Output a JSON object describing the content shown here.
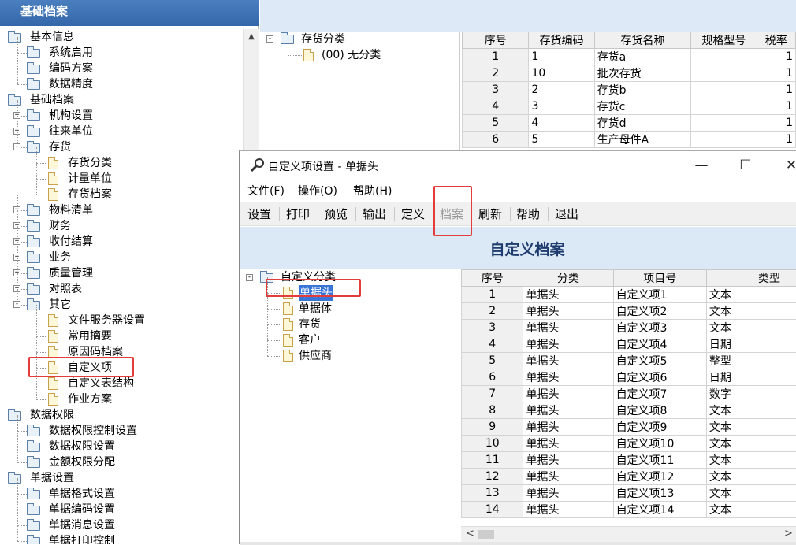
{
  "left_panel": {
    "title": "基础档案",
    "tree": [
      {
        "label": "基本信息",
        "level": 0,
        "type": "folder",
        "pm": ""
      },
      {
        "label": "系统启用",
        "level": 1,
        "type": "folder",
        "pm": ""
      },
      {
        "label": "编码方案",
        "level": 1,
        "type": "folder",
        "pm": ""
      },
      {
        "label": "数据精度",
        "level": 1,
        "type": "folder",
        "pm": ""
      },
      {
        "label": "基础档案",
        "level": 0,
        "type": "folder",
        "pm": ""
      },
      {
        "label": "机构设置",
        "level": 1,
        "type": "folder",
        "pm": "+"
      },
      {
        "label": "往来单位",
        "level": 1,
        "type": "folder",
        "pm": "+"
      },
      {
        "label": "存货",
        "level": 1,
        "type": "folder",
        "pm": "-"
      },
      {
        "label": "存货分类",
        "level": 2,
        "type": "doc",
        "pm": ""
      },
      {
        "label": "计量单位",
        "level": 2,
        "type": "doc",
        "pm": ""
      },
      {
        "label": "存货档案",
        "level": 2,
        "type": "doc",
        "pm": ""
      },
      {
        "label": "物料清单",
        "level": 1,
        "type": "folder",
        "pm": "+"
      },
      {
        "label": "财务",
        "level": 1,
        "type": "folder",
        "pm": "+"
      },
      {
        "label": "收付结算",
        "level": 1,
        "type": "folder",
        "pm": "+"
      },
      {
        "label": "业务",
        "level": 1,
        "type": "folder",
        "pm": "+"
      },
      {
        "label": "质量管理",
        "level": 1,
        "type": "folder",
        "pm": "+"
      },
      {
        "label": "对照表",
        "level": 1,
        "type": "folder",
        "pm": "+"
      },
      {
        "label": "其它",
        "level": 1,
        "type": "folder",
        "pm": "-"
      },
      {
        "label": "文件服务器设置",
        "level": 2,
        "type": "doc",
        "pm": ""
      },
      {
        "label": "常用摘要",
        "level": 2,
        "type": "doc",
        "pm": ""
      },
      {
        "label": "原因码档案",
        "level": 2,
        "type": "doc",
        "pm": ""
      },
      {
        "label": "自定义项",
        "level": 2,
        "type": "doc",
        "pm": ""
      },
      {
        "label": "自定义表结构",
        "level": 2,
        "type": "doc",
        "pm": ""
      },
      {
        "label": "作业方案",
        "level": 2,
        "type": "doc",
        "pm": ""
      },
      {
        "label": "数据权限",
        "level": 0,
        "type": "folder",
        "pm": ""
      },
      {
        "label": "数据权限控制设置",
        "level": 1,
        "type": "folder",
        "pm": ""
      },
      {
        "label": "数据权限设置",
        "level": 1,
        "type": "folder",
        "pm": ""
      },
      {
        "label": "金额权限分配",
        "level": 1,
        "type": "folder",
        "pm": ""
      },
      {
        "label": "单据设置",
        "level": 0,
        "type": "folder",
        "pm": ""
      },
      {
        "label": "单据格式设置",
        "level": 1,
        "type": "folder",
        "pm": ""
      },
      {
        "label": "单据编码设置",
        "level": 1,
        "type": "folder",
        "pm": ""
      },
      {
        "label": "单据消息设置",
        "level": 1,
        "type": "folder",
        "pm": ""
      },
      {
        "label": "单据打印控制",
        "level": 1,
        "type": "folder",
        "pm": ""
      }
    ]
  },
  "bg_window": {
    "tree_root": "存货分类",
    "tree_child": "(00) 无分类",
    "columns": [
      "序号",
      "存货编码",
      "存货名称",
      "规格型号",
      "税率"
    ],
    "rows": [
      [
        "1",
        "1",
        "存货a",
        "",
        "1"
      ],
      [
        "2",
        "10",
        "批次存货",
        "",
        "1"
      ],
      [
        "3",
        "2",
        "存货b",
        "",
        "1"
      ],
      [
        "4",
        "3",
        "存货c",
        "",
        "1"
      ],
      [
        "5",
        "4",
        "存货d",
        "",
        "1"
      ],
      [
        "6",
        "5",
        "生产母件A",
        "",
        "1"
      ]
    ]
  },
  "dialog": {
    "title": "自定义项设置 - 单据头",
    "window_buttons": {
      "minimize": "—",
      "maximize": "☐",
      "close": "✕"
    },
    "menu": [
      "文件(F)",
      "操作(O)",
      "帮助(H)"
    ],
    "toolbar": [
      "设置",
      "打印",
      "预览",
      "输出",
      "定义",
      "档案",
      "刷新",
      "帮助",
      "退出"
    ],
    "banner": "自定义档案",
    "tree_root": "自定义分类",
    "tree_items": [
      "单据头",
      "单据体",
      "存货",
      "客户",
      "供应商"
    ],
    "columns": [
      "序号",
      "分类",
      "项目号",
      "类型"
    ],
    "rows": [
      [
        "1",
        "单据头",
        "自定义项1",
        "文本"
      ],
      [
        "2",
        "单据头",
        "自定义项2",
        "文本"
      ],
      [
        "3",
        "单据头",
        "自定义项3",
        "文本"
      ],
      [
        "4",
        "单据头",
        "自定义项4",
        "日期"
      ],
      [
        "5",
        "单据头",
        "自定义项5",
        "整型"
      ],
      [
        "6",
        "单据头",
        "自定义项6",
        "日期"
      ],
      [
        "7",
        "单据头",
        "自定义项7",
        "数字"
      ],
      [
        "8",
        "单据头",
        "自定义项8",
        "文本"
      ],
      [
        "9",
        "单据头",
        "自定义项9",
        "文本"
      ],
      [
        "10",
        "单据头",
        "自定义项10",
        "文本"
      ],
      [
        "11",
        "单据头",
        "自定义项11",
        "文本"
      ],
      [
        "12",
        "单据头",
        "自定义项12",
        "文本"
      ],
      [
        "13",
        "单据头",
        "自定义项13",
        "文本"
      ],
      [
        "14",
        "单据头",
        "自定义项14",
        "文本"
      ]
    ]
  },
  "colors": {
    "highlight": "#e43b3b",
    "header_blue": "#3466aa",
    "banner_bg": "#dbe8f5",
    "selection": "#3875d7"
  }
}
